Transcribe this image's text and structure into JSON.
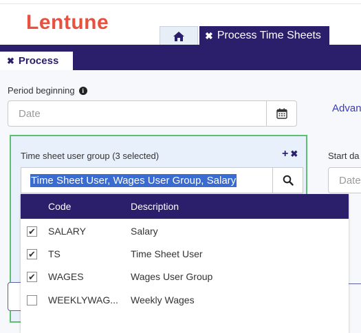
{
  "header": {
    "logo_text": "Lentune",
    "tabs": [
      {
        "icon": "home-icon"
      },
      {
        "label": "Process Time Sheets",
        "close": "✖"
      }
    ]
  },
  "subtab": {
    "label": "Process",
    "close": "✖"
  },
  "period": {
    "label": "Period beginning",
    "info": "i",
    "placeholder": "Date"
  },
  "advanced_link": "Advan",
  "user_group": {
    "label": "Time sheet user group (3 selected)",
    "actions": {
      "add": "+",
      "clear": "✖"
    },
    "value": "Time Sheet User, Wages User Group, Salary"
  },
  "start_date": {
    "label": "Start da",
    "placeholder": "Date"
  },
  "dropdown": {
    "headers": {
      "code": "Code",
      "description": "Description"
    },
    "rows": [
      {
        "code": "SALARY",
        "description": "Salary",
        "checked": true
      },
      {
        "code": "TS",
        "description": "Time Sheet User",
        "checked": true
      },
      {
        "code": "WAGES",
        "description": "Wages User Group",
        "checked": true
      },
      {
        "code": "WEEKLYWAG...",
        "description": "Weekly Wages",
        "checked": false
      }
    ]
  },
  "colors": {
    "brand": "#e8503f",
    "nav": "#2b1f6b",
    "selection": "#3a6bd0",
    "panel_border": "#5cbf72",
    "link": "#3b3bb3"
  }
}
